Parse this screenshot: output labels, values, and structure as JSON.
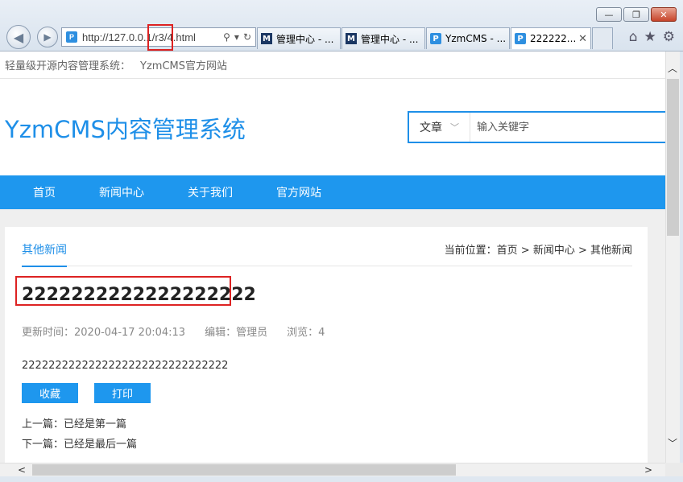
{
  "browser": {
    "window_controls": {
      "minimize": "—",
      "restore": "❐",
      "close": "✕"
    },
    "url": "http://127.0.0.1/r3/4.html",
    "tabs": [
      {
        "icon": "M",
        "title": "管理中心 - ..."
      },
      {
        "icon": "M",
        "title": "管理中心 - ..."
      },
      {
        "icon": "Y",
        "title": "YzmCMS - ..."
      },
      {
        "icon": "Y",
        "title": "222222...",
        "active": true,
        "close": "✕"
      }
    ],
    "tools": {
      "home": "⌂",
      "favorites": "★",
      "settings": "⚙"
    }
  },
  "page": {
    "topbar": {
      "text1": "轻量级开源内容管理系统：",
      "text2": "YzmCMS官方网站"
    },
    "header": {
      "site_title": "YzmCMS内容管理系统",
      "search_category": "文章",
      "search_placeholder": "输入关键字"
    },
    "nav": [
      "首页",
      "新闻中心",
      "关于我们",
      "官方网站"
    ],
    "content": {
      "category_tab": "其他新闻",
      "breadcrumb": "当前位置：首页 > 新闻中心 > 其他新闻",
      "article_title": "2222222222222222222",
      "meta": {
        "updated": "更新时间：2020-04-17 20:04:13",
        "editor": "编辑：管理员",
        "views": "浏览：4"
      },
      "body": "2222222222222222222222222222222",
      "buttons": {
        "favorite": "收藏",
        "print": "打印"
      },
      "prev": "上一篇：已经是第一篇",
      "next": "下一篇：已经是最后一篇"
    }
  },
  "colors": {
    "brand": "#1e8fe8",
    "nav_bg": "#1e97ee",
    "highlight": "#dd2222"
  }
}
